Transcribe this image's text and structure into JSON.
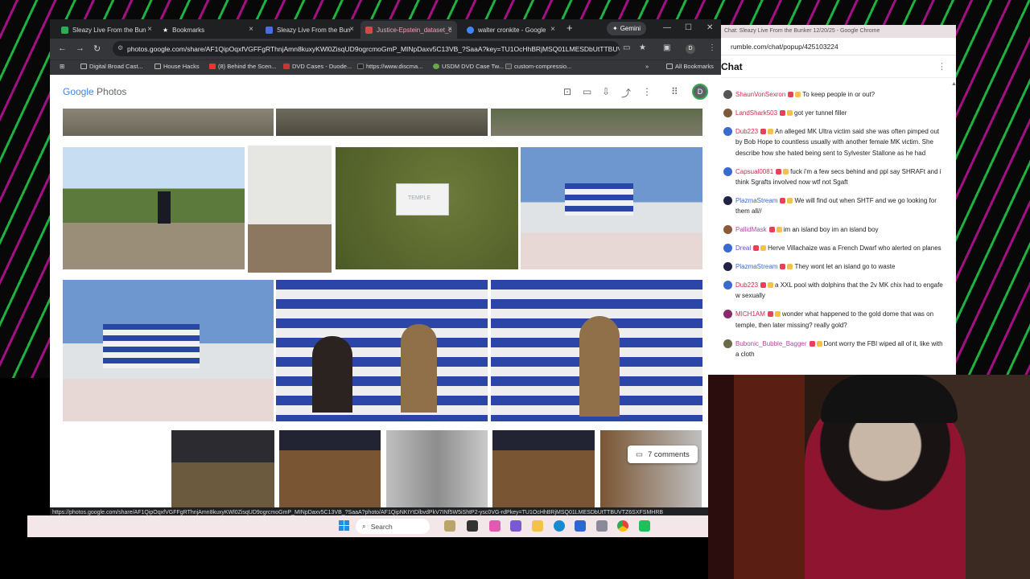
{
  "browser": {
    "tabs": [
      {
        "title": "Sleazy Live From the Bun",
        "color": "#34a853"
      },
      {
        "title": "Bookmarks",
        "color": "#ffffff"
      },
      {
        "title": "Sleazy Live From the Bun",
        "color": "#4a6ee0"
      },
      {
        "title": "Justice-Epstein_dataset_c",
        "color": "#d04a4a"
      },
      {
        "title": "walter cronkite - Google",
        "color": "#4285f4"
      }
    ],
    "gemini_label": "Gemini",
    "url": "photos.google.com/share/AF1QipOqxfVGFFgRThnjAmn8kuxyKWl0ZisqUD9ogrcmoGmP_MINpDaxv5C13VB_?SaaA?key=TU1OcHhBRjMSQ01LMESDbUtTTBUVT...",
    "bookmarks": [
      "Digital Broad Cast...",
      "House Hacks",
      "(8) Behind the Scen...",
      "DVD Cases - Duode...",
      "https://www.discma...",
      "USDM DVD Case Tw...",
      "custom-compressio..."
    ],
    "all_bookmarks": "All Bookmarks",
    "status_url": "https://photos.google.com/share/AF1QipOqxfVGFFgRThnjAmn8kuxyKWl0ZisqUD9ogrcmoGmP_MINpDaxv5C13VB_?SaaA?photo/AF1QipNKtYtDlbvdPkV7INf5W5iShtP2-ysc0VG-rdPkey=TU1OcHhBRjMSQ01LMESDbUtTTBUVTZ6SXFSMHRB"
  },
  "photos": {
    "logo_google": "Google",
    "logo_photos": "Photos",
    "avatar_letter": "D",
    "comments_label": "7 comments",
    "paper_text": "TEMPLE"
  },
  "taskbar": {
    "search_label": "Search"
  },
  "chat": {
    "window_title": "Chat: Sleazy Live From the Bunker 12/20/25 - Google Chrome",
    "url": "rumble.com/chat/popup/425103224",
    "header": "Chat",
    "messages": [
      {
        "user": "ShaunVonSexron",
        "text": "To keep people in or out?",
        "color": "#d02a4a",
        "avatar": "#555555"
      },
      {
        "user": "LandShark503",
        "text": "got yer tunnel filler",
        "color": "#d02a4a",
        "avatar": "#7a5a3a"
      },
      {
        "user": "Dub223",
        "text": "An alleged MK Ultra victim said she was often pimped out by Bob Hope to countless usually with another female MK victim. She describe how she hated being sent to Sylvester Stallone as he had",
        "color": "#d02a4a",
        "avatar": "#3a6ad0"
      },
      {
        "user": "Capsual0081",
        "text": "fuck i'm a few secs behind and ppl say SHRAFt and i think Sgrafts involved now wtf not Sgaft",
        "color": "#d02a4a",
        "avatar": "#3a6ad0"
      },
      {
        "user": "PlazmaStream",
        "text": "We will find out when SHTF and we go looking for them all//",
        "color": "#3a6ad0",
        "avatar": "#222244"
      },
      {
        "user": "PallidMask",
        "text": "im an island boy im an island boy",
        "color": "#b04aa0",
        "avatar": "#8a5a3a"
      },
      {
        "user": "Dreal",
        "text": "Herve Villachaize was a French Dwarf who alerted on planes",
        "color": "#6a4ad0",
        "avatar": "#3a6ad0"
      },
      {
        "user": "PlazmaStream",
        "text": "They wont let an island go to waste",
        "color": "#3a6ad0",
        "avatar": "#222244"
      },
      {
        "user": "Dub223",
        "text": "a XXL pool with dolphins that the 2v MK chix had to engafe w sexually",
        "color": "#d02a4a",
        "avatar": "#3a6ad0"
      },
      {
        "user": "MICH1AM",
        "text": "wonder what happened to the gold dome that was on temple, then later missing? really gold?",
        "color": "#d02a4a",
        "avatar": "#8a2a6a"
      },
      {
        "user": "Bubonic_Bubble_Bagger",
        "text": "Dont worry the FBI wiped all of it, like with a cloth",
        "color": "#b04aa0",
        "avatar": "#6a6a4a"
      }
    ]
  }
}
